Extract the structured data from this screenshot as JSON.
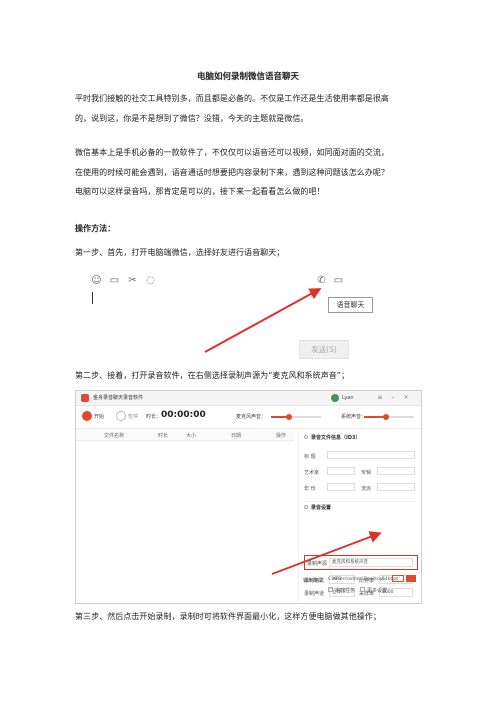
{
  "doc": {
    "title": "电脑如何录制微信语音聊天",
    "para1_line1": "平时我们接触的社交工具特别多，而且都是必备的。不仅是工作还是生活使用率都是很高",
    "para1_line2": "的，说到这，你是不是想到了微信？没错，今天的主题就是微信。",
    "para2_line1": "微信基本上是手机必备的一款软件了，不仅仅可以语音还可以视频，如同面对面的交流，",
    "para2_line2": "在使用的时候可能会遇到，语音通话时想要把内容录制下来，遇到这种问题该怎么办呢？",
    "para2_line3": "电脑可以这样录音吗，那肯定是可以的，接下来一起看看怎么做的吧！",
    "method_heading": "操作方法：",
    "step1": "第一步、首先，打开电脑端微信，选择好友进行语音聊天；",
    "step2": "第二步、接着，打开录音软件，在右侧选择录制声源为“麦克风和系统声音”；",
    "step3": "第三步、然后点击开始录制，录制时可将软件界面最小化，这样方便电脑做其他操作；"
  },
  "wechat": {
    "tooltip": "语音聊天",
    "send_label": "发送(S)",
    "icons": [
      "smile-icon",
      "folder-icon",
      "scissors-icon",
      "chat-bubble-icon",
      "phone-icon",
      "video-icon"
    ]
  },
  "recorder": {
    "app_title": "金舟录音聊天录音软件",
    "username": "Lyan",
    "start_label": "开始",
    "pause_label": "暂停",
    "time_label": "时长：",
    "timer": "00:00:00",
    "mic_label": "麦克风声音：",
    "sys_label": "系统声音：",
    "table_headers": [
      "文件名称",
      "时长",
      "大小",
      "日期",
      "操作"
    ],
    "file_info_section": "录音文件信息（ID3）",
    "fields": {
      "title": "标 题",
      "artist": "艺术家",
      "album": "专辑",
      "year": "年 份",
      "genre": "流派"
    },
    "settings_section": "录音设置",
    "source_label": "录制声源",
    "source_value": "麦克风和系统声音",
    "format_label": "录制格式",
    "format_value": "MP3",
    "bitrate_label": "比特率",
    "bitrate_value": "64kbps",
    "channel_label": "录制声道",
    "channel_value": "立体声",
    "samplerate_label": "采样率",
    "samplerate_value": "8000",
    "output_label": "输出目录",
    "output_value": "C:\\Users\\admin\\Desktop\\",
    "scheduled_label": "定时任务",
    "more_label": "更多设置",
    "accent": "#e0492f"
  }
}
